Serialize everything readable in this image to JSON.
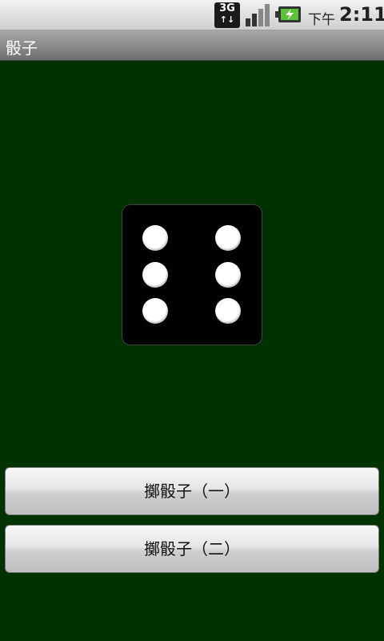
{
  "status_bar": {
    "network_type": "3G",
    "ampm": "下午",
    "time": "2:11",
    "icons": [
      "3g-data-icon",
      "signal-strength-icon",
      "battery-charging-icon"
    ]
  },
  "app": {
    "title": "骰子"
  },
  "die": {
    "face_value": 6,
    "pip_color": "#ffffff",
    "body_color": "#000000"
  },
  "buttons": {
    "roll_one": "擲骰子（一）",
    "roll_two": "擲骰子（二）"
  },
  "colors": {
    "background": "#003100"
  }
}
